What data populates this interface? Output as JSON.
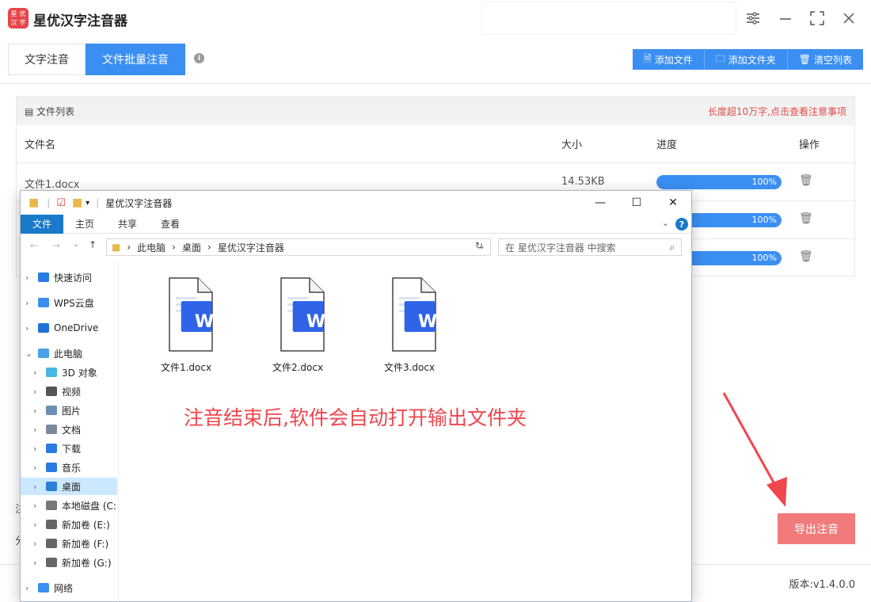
{
  "app": {
    "title": "星优汉字注音器",
    "logo_chars": [
      "星",
      "优",
      "汉",
      "字"
    ]
  },
  "tabs": [
    {
      "label": "文字注音",
      "active": false
    },
    {
      "label": "文件批量注音",
      "active": true
    }
  ],
  "toolbar": {
    "add_file": "添加文件",
    "add_folder": "添加文件夹",
    "clear_list": "清空列表"
  },
  "file_panel": {
    "title": "文件列表",
    "warning": "长度超10万字,点击查看注意事项",
    "columns": [
      "文件名",
      "大小",
      "进度",
      "操作"
    ],
    "rows": [
      {
        "name": "文件1.docx",
        "size": "14.53KB",
        "progress": 100,
        "progress_label": "100%"
      },
      {
        "name": "",
        "size": "",
        "progress": 100,
        "progress_label": "100%"
      },
      {
        "name": "",
        "size": "",
        "progress": 100,
        "progress_label": "100%"
      }
    ]
  },
  "export_button": "导出注音",
  "version": "版本:v1.4.0.0",
  "left_stub": [
    "注",
    "分"
  ],
  "explorer": {
    "title": "星优汉字注音器",
    "ribbon_tabs": [
      "文件",
      "主页",
      "共享",
      "查看"
    ],
    "breadcrumb": [
      "此电脑",
      "桌面",
      "星优汉字注音器"
    ],
    "search_placeholder": "在 星优汉字注音器 中搜索",
    "nav": [
      {
        "label": "快速访问",
        "icon": "star-icon",
        "level": 0
      },
      {
        "label": "WPS云盘",
        "icon": "cloud-icon",
        "level": 0
      },
      {
        "label": "OneDrive",
        "icon": "onedrive-icon",
        "level": 0
      },
      {
        "label": "此电脑",
        "icon": "computer-icon",
        "level": 0,
        "expanded": true
      },
      {
        "label": "3D 对象",
        "icon": "cube-icon",
        "level": 1
      },
      {
        "label": "视频",
        "icon": "video-icon",
        "level": 1
      },
      {
        "label": "图片",
        "icon": "picture-icon",
        "level": 1
      },
      {
        "label": "文档",
        "icon": "document-icon",
        "level": 1
      },
      {
        "label": "下载",
        "icon": "download-icon",
        "level": 1
      },
      {
        "label": "音乐",
        "icon": "music-icon",
        "level": 1
      },
      {
        "label": "桌面",
        "icon": "desktop-icon",
        "level": 1,
        "selected": true
      },
      {
        "label": "本地磁盘 (C:",
        "icon": "disk-icon",
        "level": 1
      },
      {
        "label": "新加卷 (E:)",
        "icon": "drive-icon",
        "level": 1
      },
      {
        "label": "新加卷 (F:)",
        "icon": "drive-icon",
        "level": 1
      },
      {
        "label": "新加卷 (G:)",
        "icon": "drive-icon",
        "level": 1
      },
      {
        "label": "网络",
        "icon": "network-icon",
        "level": 0
      }
    ],
    "files": [
      "文件1.docx",
      "文件2.docx",
      "文件3.docx"
    ],
    "word_letter": "W"
  },
  "annotation": "注音结束后,软件会自动打开输出文件夹",
  "colors": {
    "accent": "#3b8ff3",
    "export": "#f17b7b",
    "warn": "#e24b4b",
    "annotation": "#f0464e"
  }
}
